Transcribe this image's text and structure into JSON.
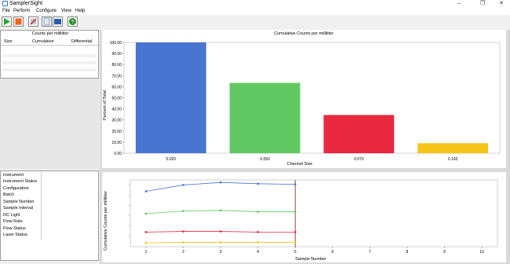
{
  "window": {
    "title": "SamplerSight",
    "minimize": "–",
    "maximize": "❐",
    "close": "✕"
  },
  "menu": [
    "File",
    "Perform",
    "Configure",
    "View",
    "Help"
  ],
  "toolbar": [
    {
      "icon": "play-icon",
      "color": "#22a630"
    },
    {
      "icon": "stop-icon",
      "color": "#e8651c"
    },
    {
      "icon": "tools-icon",
      "color": "#7a5fa8"
    },
    {
      "icon": "document-icon",
      "color": "#6f8fb8"
    },
    {
      "icon": "book-icon",
      "color": "#2b5ea8"
    },
    {
      "icon": "help-icon",
      "color": "#2f8f2f"
    }
  ],
  "table": {
    "title": "Counts per milliliter",
    "columns": [
      "Size",
      "Cumulative",
      "Differential"
    ]
  },
  "status_labels": [
    "Instrument",
    "Instrument Status",
    "Configuration",
    "Batch",
    "Sample Number",
    "Sample Interval",
    "DC Light",
    "Flow Rate",
    "Flow Status",
    "Laser Status"
  ],
  "chart_data": [
    {
      "type": "bar",
      "title": "Cumulative Counts per milliliter",
      "xlabel": "Channel Size",
      "ylabel": "Percent of Total",
      "categories": [
        "0.020",
        "0.050",
        "0.070",
        "0.100"
      ],
      "values": [
        100.0,
        63.5,
        34.5,
        9.0
      ],
      "colors": [
        "#4a74d2",
        "#62c962",
        "#e8283f",
        "#f5c518"
      ],
      "yticks": [
        "0.00",
        "10.00",
        "20.00",
        "30.00",
        "40.00",
        "50.00",
        "60.00",
        "70.00",
        "80.00",
        "90.00",
        "100.00"
      ],
      "ylim": [
        0,
        100
      ]
    },
    {
      "type": "line",
      "xlabel": "Sample Number",
      "ylabel": "Cumulative Counts per milliliter",
      "x": [
        1,
        2,
        3,
        4,
        5
      ],
      "xticks": [
        "1",
        "2",
        "3",
        "4",
        "5",
        "6",
        "7",
        "8",
        "9",
        "10"
      ],
      "xlim": [
        1,
        10
      ],
      "ylim": [
        0,
        1
      ],
      "series": [
        {
          "color": "#4a74d2",
          "values": [
            0.87,
            0.97,
            1.01,
            0.99,
            0.98
          ]
        },
        {
          "color": "#62c962",
          "values": [
            0.52,
            0.56,
            0.57,
            0.55,
            0.55
          ]
        },
        {
          "color": "#e8283f",
          "values": [
            0.23,
            0.24,
            0.24,
            0.23,
            0.23
          ]
        },
        {
          "color": "#f5c518",
          "values": [
            0.06,
            0.07,
            0.07,
            0.07,
            0.07
          ]
        }
      ],
      "marker_x": 5
    }
  ]
}
